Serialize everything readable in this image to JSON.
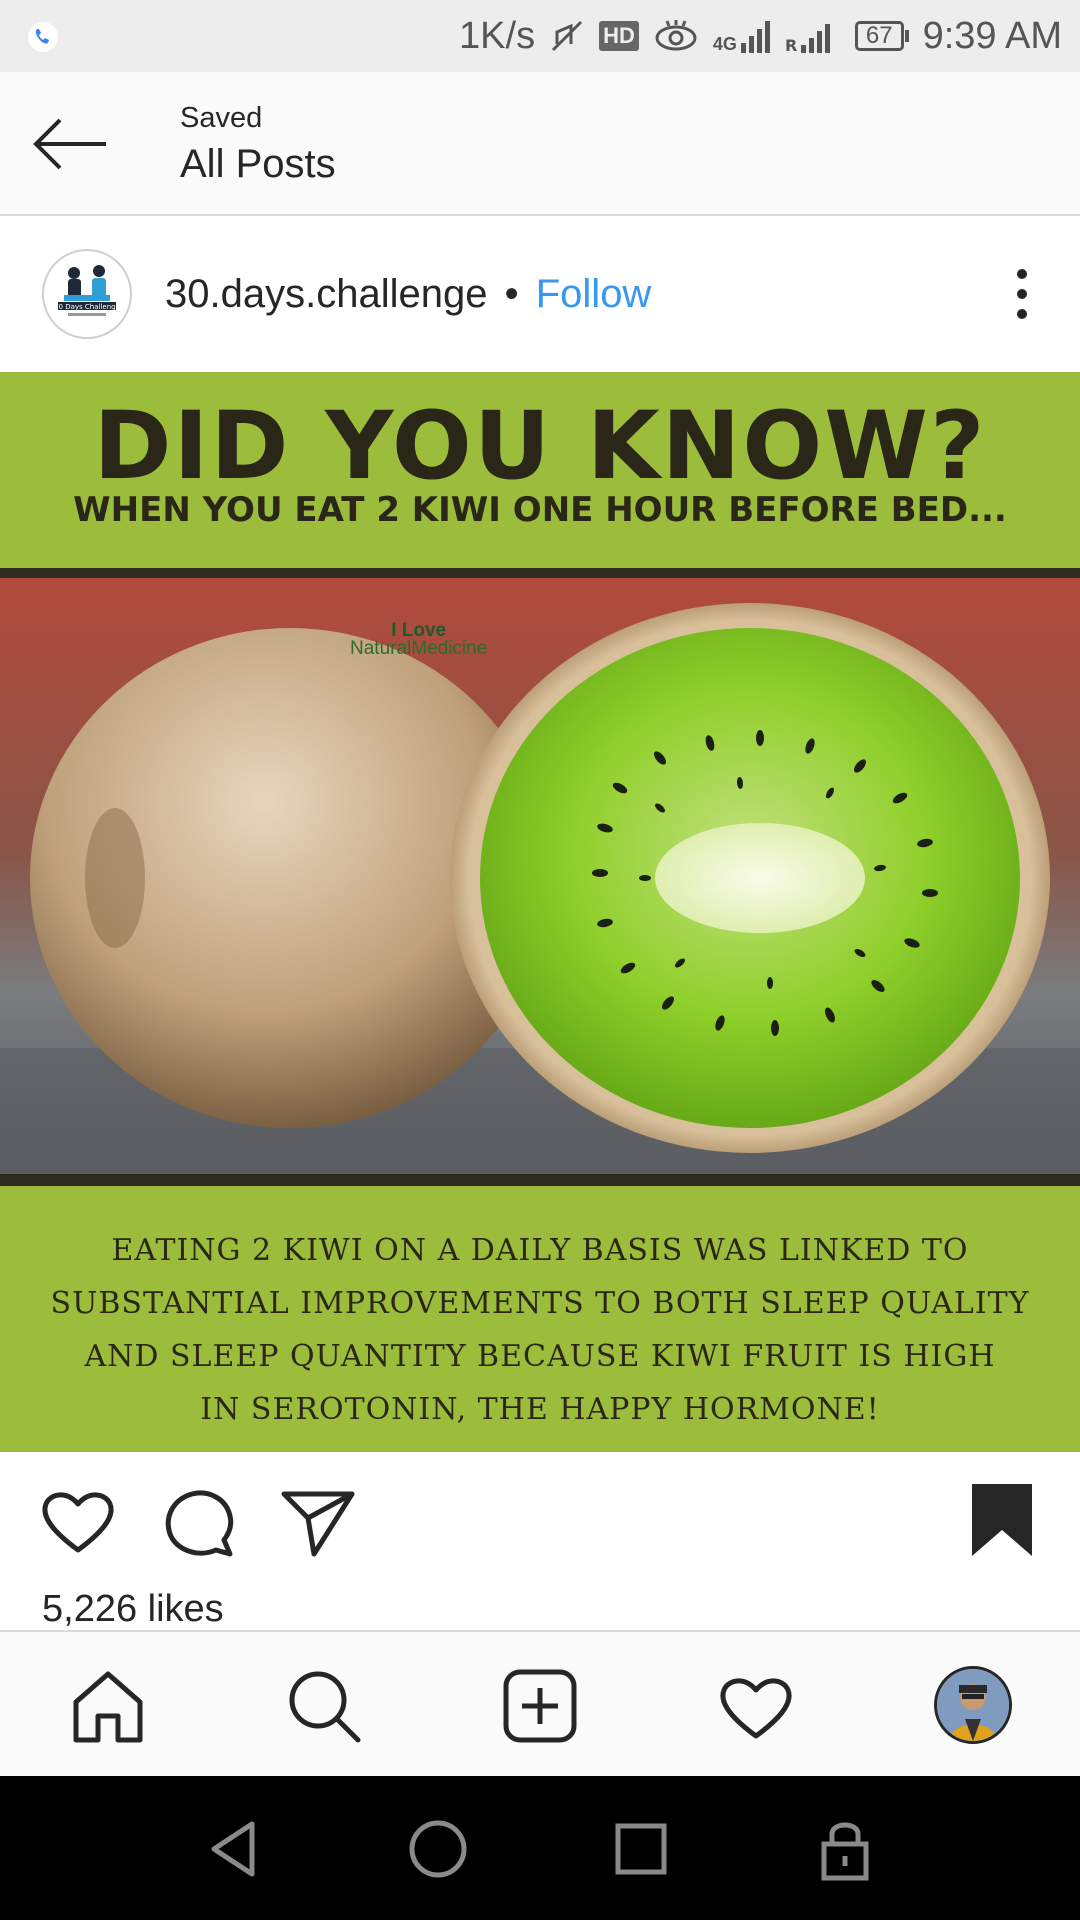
{
  "status_bar": {
    "net_speed": "1K/s",
    "hd_badge": "HD",
    "network_4g": "4G",
    "battery": "67",
    "time": "9:39 AM"
  },
  "header": {
    "subtitle": "Saved",
    "title": "All Posts"
  },
  "post": {
    "username": "30.days.challenge",
    "separator": "•",
    "follow_label": "Follow",
    "avatar_text": "30 Days Challenge",
    "image": {
      "headline": "DID YOU KNOW?",
      "subheadline": "WHEN YOU EAT 2 KIWI ONE HOUR BEFORE BED...",
      "watermark_line1": "I Love",
      "watermark_line2": "NaturalMedicine",
      "caption_lines": [
        "EATING 2 KIWI ON A DAILY BASIS WAS LINKED TO",
        "SUBSTANTIAL IMPROVEMENTS TO BOTH SLEEP QUALITY",
        "AND SLEEP QUANTITY BECAUSE KIWI FRUIT IS HIGH",
        "IN SEROTONIN, THE HAPPY HORMONE!"
      ]
    },
    "likes": "5,226 likes"
  },
  "bottom_nav": {
    "items": [
      "home-icon",
      "search-icon",
      "new-post-icon",
      "activity-heart-icon",
      "profile-avatar"
    ]
  },
  "colors": {
    "follow_blue": "#3897f0",
    "banner_green": "#9cbd3b",
    "dark_text": "#262626"
  }
}
